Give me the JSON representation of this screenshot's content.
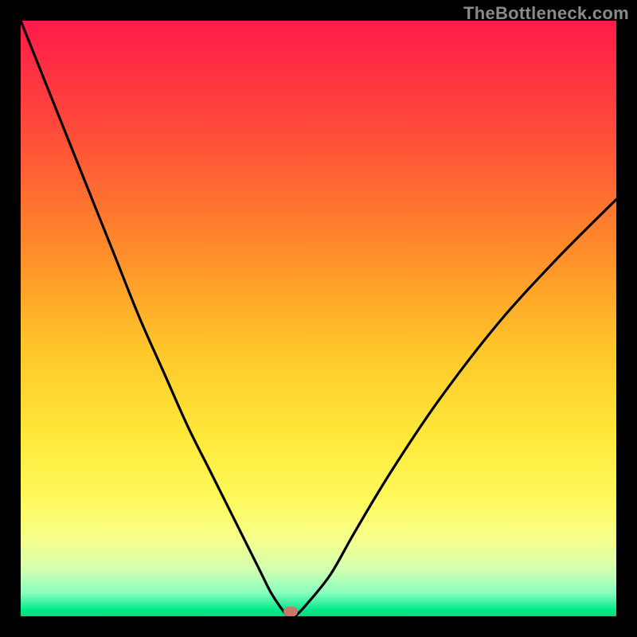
{
  "watermark": "TheBottleneck.com",
  "colors": {
    "frame": "#000000",
    "gradient_top": "#ff1a4a",
    "gradient_bottom": "#00e070",
    "curve": "#000000",
    "marker": "#c67a6a",
    "watermark_text": "#8a8a8a"
  },
  "chart_data": {
    "type": "line",
    "title": "",
    "xlabel": "",
    "ylabel": "",
    "xlim": [
      0,
      100
    ],
    "ylim": [
      0,
      100
    ],
    "grid": false,
    "legend": false,
    "series": [
      {
        "name": "bottleneck-curve",
        "x": [
          0,
          4,
          8,
          12,
          16,
          20,
          24,
          28,
          32,
          36,
          40,
          42,
          44,
          45,
          46,
          48,
          52,
          56,
          62,
          70,
          80,
          90,
          100
        ],
        "y": [
          100,
          90,
          80,
          70,
          60,
          50,
          41,
          32,
          24,
          16,
          8,
          4,
          1,
          0,
          0,
          2,
          7,
          14,
          24,
          36,
          49,
          60,
          70
        ]
      }
    ],
    "annotations": [
      {
        "name": "min-marker",
        "x": 45.3,
        "y": 0.8
      }
    ]
  }
}
